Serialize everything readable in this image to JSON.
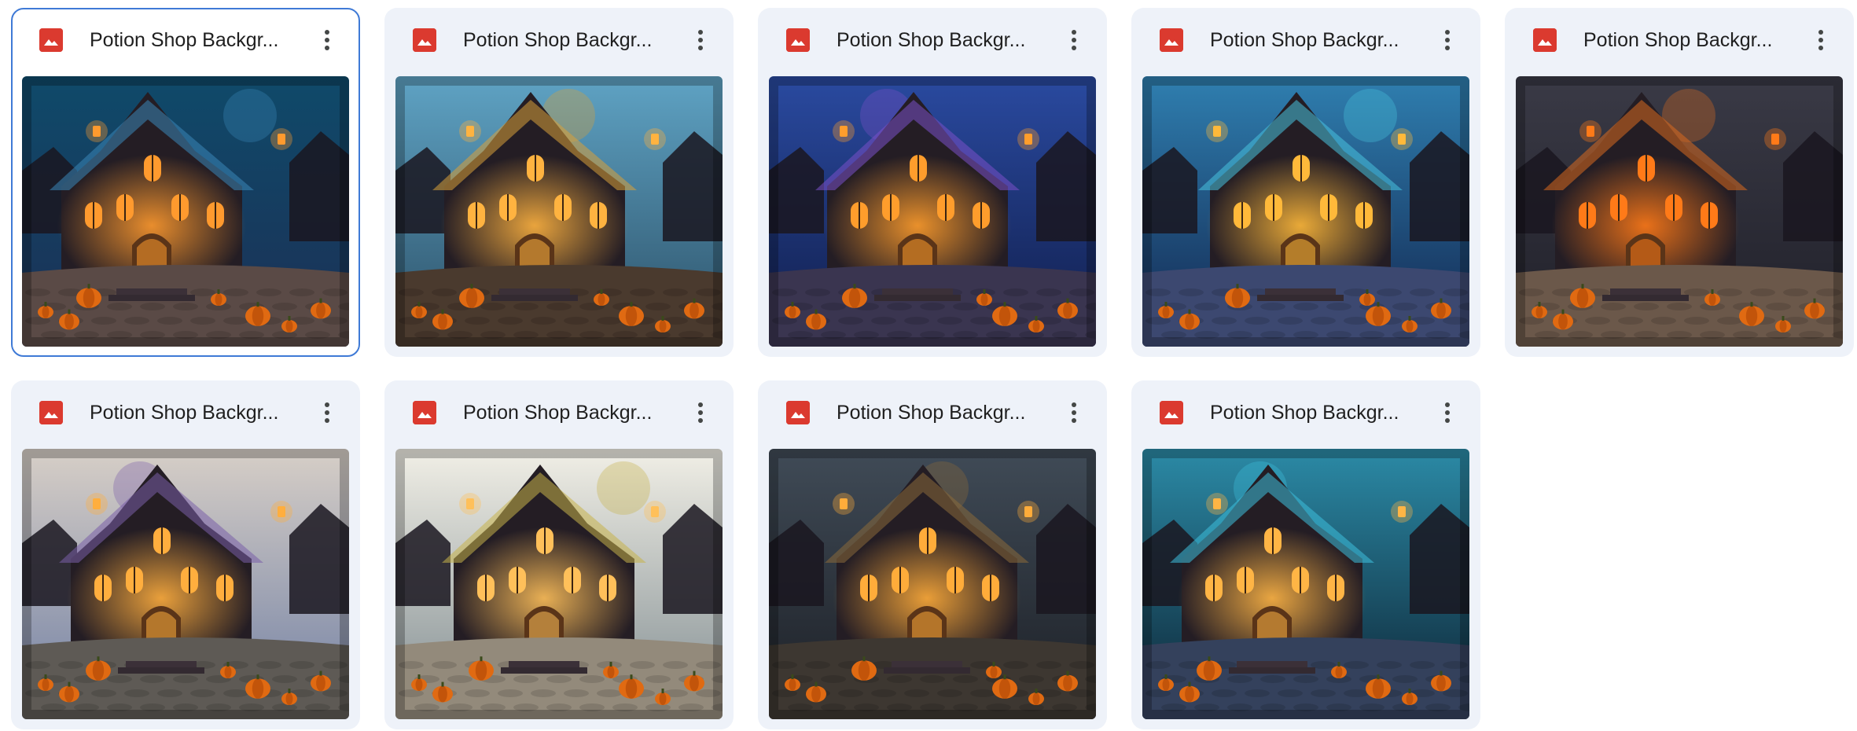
{
  "files": [
    {
      "name": "Potion Shop Backgr...",
      "selected": true,
      "sky": [
        "#0f4a6a",
        "#1c2f55"
      ],
      "ground": "#5a4a46",
      "glow": "#ff9a2e",
      "accent": "#3a86b8"
    },
    {
      "name": "Potion Shop Backgr...",
      "selected": false,
      "sky": [
        "#5fa3c4",
        "#2b4f66"
      ],
      "ground": "#4a3a2e",
      "glow": "#ffb340",
      "accent": "#d8a13a"
    },
    {
      "name": "Potion Shop Backgr...",
      "selected": false,
      "sky": [
        "#2a4aa0",
        "#101d4a"
      ],
      "ground": "#3a3550",
      "glow": "#ff9d2c",
      "accent": "#7a50c8"
    },
    {
      "name": "Potion Shop Backgr...",
      "selected": false,
      "sky": [
        "#2f7fb0",
        "#12254e"
      ],
      "ground": "#3c4870",
      "glow": "#ffb93a",
      "accent": "#49c3de"
    },
    {
      "name": "Potion Shop Backgr...",
      "selected": false,
      "sky": [
        "#3a3a46",
        "#1f1f28"
      ],
      "ground": "#6b584a",
      "glow": "#ff7a18",
      "accent": "#d86a1f"
    },
    {
      "name": "Potion Shop Backgr...",
      "selected": false,
      "sky": [
        "#d7cfc7",
        "#6f7ea3"
      ],
      "ground": "#5e5a55",
      "glow": "#ffae3e",
      "accent": "#7a5ea8"
    },
    {
      "name": "Potion Shop Backgr...",
      "selected": false,
      "sky": [
        "#f1efe6",
        "#7f8b90"
      ],
      "ground": "#938a7b",
      "glow": "#ffc05a",
      "accent": "#c7b34a"
    },
    {
      "name": "Potion Shop Backgr...",
      "selected": false,
      "sky": [
        "#404b57",
        "#1b1e24"
      ],
      "ground": "#3d3731",
      "glow": "#ffac3a",
      "accent": "#8b6a3a"
    },
    {
      "name": "Potion Shop Backgr...",
      "selected": false,
      "sky": [
        "#2b8aa6",
        "#0d2232"
      ],
      "ground": "#34415c",
      "glow": "#ffb545",
      "accent": "#3ec0dc"
    }
  ],
  "icons": {
    "file_type": "image-file-icon",
    "more": "more-vert-icon"
  },
  "colors": {
    "card_bg": "#eef2f9",
    "selected_border": "#3f7ad6",
    "image_icon": "#db3a2f"
  }
}
